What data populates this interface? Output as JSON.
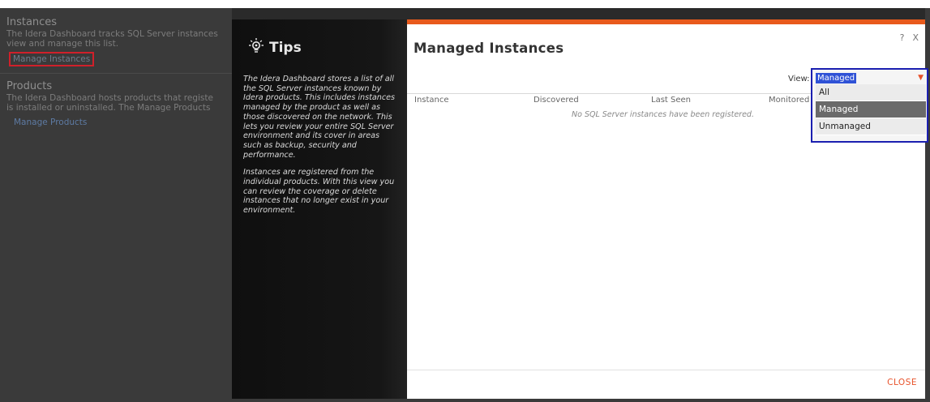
{
  "background": {
    "instances": {
      "title": "Instances",
      "text_line1": "The Idera Dashboard tracks SQL Server instances",
      "text_line2": "view and manage this list.",
      "link": "Manage Instances"
    },
    "products": {
      "title": "Products",
      "text_line1": "The Idera Dashboard hosts products that registe",
      "text_line2": "is installed or uninstalled. The Manage Products",
      "link": "Manage Products"
    }
  },
  "tips": {
    "title": "Tips",
    "icon": "lightbulb-icon",
    "paragraph1": "The Idera Dashboard stores a list of all the SQL Server instances known by Idera products. This includes instances managed by the product as well as those discovered on the network. This lets you review your entire SQL Server environment and its cover in areas such as backup, security and performance.",
    "paragraph2": "Instances are registered from the individual products. With this view you can review the coverage or delete instances that no longer exist in your environment."
  },
  "dialog": {
    "title": "Managed Instances",
    "help": "?",
    "close_x": "X",
    "view_label": "View:",
    "columns": [
      "Instance",
      "Discovered",
      "Last Seen",
      "Monitored"
    ],
    "empty_message": "No SQL Server instances have been registered.",
    "close_button": "CLOSE",
    "accent_color": "#e85a1c"
  },
  "dropdown": {
    "selected": "Managed",
    "options": [
      "All",
      "Managed",
      "Unmanaged"
    ]
  }
}
